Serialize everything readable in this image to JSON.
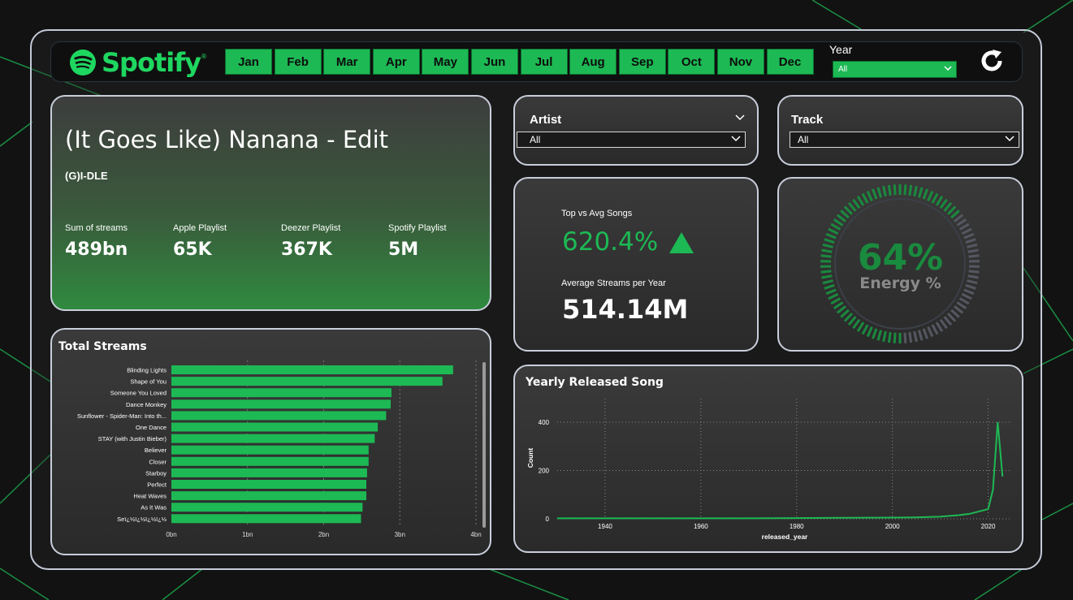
{
  "brand": {
    "name": "Spotify",
    "color": "#1db954"
  },
  "months": [
    "Jan",
    "Feb",
    "Mar",
    "Apr",
    "May",
    "Jun",
    "Jul",
    "Aug",
    "Sep",
    "Oct",
    "Nov",
    "Dec"
  ],
  "year_filter": {
    "label": "Year",
    "value": "All"
  },
  "refresh_icon": "refresh-icon",
  "top_song": {
    "title": "(It Goes Like) Nanana - Edit",
    "artist": "(G)I-DLE",
    "kpis": [
      {
        "label": "Sum of streams",
        "value": "489bn"
      },
      {
        "label": "Apple Playlist",
        "value": "65K"
      },
      {
        "label": "Deezer Playlist",
        "value": "367K"
      },
      {
        "label": "Spotify Playlist",
        "value": "5M"
      }
    ]
  },
  "artist_filter": {
    "label": "Artist",
    "value": "All"
  },
  "track_filter": {
    "label": "Track",
    "value": "All"
  },
  "top_vs_avg": {
    "label": "Top vs Avg Songs",
    "value": "620.4%",
    "trend_icon": "up-triangle-icon",
    "avg_label": "Average Streams per Year",
    "avg_value": "514.14M"
  },
  "energy": {
    "value": "64%",
    "label": "Energy %",
    "fraction": 0.64
  },
  "total_streams": {
    "title": "Total Streams",
    "chart_data": {
      "type": "bar",
      "orientation": "horizontal",
      "categories": [
        "Blinding Lights",
        "Shape of You",
        "Someone You Loved",
        "Dance Monkey",
        "Sunflower - Spider-Man: Into th...",
        "One Dance",
        "STAY (with Justin Bieber)",
        "Believer",
        "Closer",
        "Starboy",
        "Perfect",
        "Heat Waves",
        "As It Was",
        "Seï¿½ï¿½ï¿½ï¿½"
      ],
      "values": [
        3.7,
        3.56,
        2.89,
        2.88,
        2.82,
        2.71,
        2.67,
        2.59,
        2.59,
        2.57,
        2.56,
        2.56,
        2.51,
        2.49
      ],
      "xticks": [
        "0bn",
        "1bn",
        "2bn",
        "3bn",
        "4bn"
      ],
      "xlim": [
        0,
        4
      ],
      "color": "#1db954",
      "grid": true
    }
  },
  "yearly_released": {
    "title": "Yearly Released Song",
    "chart_data": {
      "type": "line",
      "xlabel": "released_year",
      "ylabel": "Count",
      "xticks": [
        1940,
        1960,
        1980,
        2000,
        2020
      ],
      "yticks": [
        0,
        200,
        400
      ],
      "xlim": [
        1930,
        2025
      ],
      "ylim": [
        0,
        420
      ],
      "color": "#1db954",
      "grid": true,
      "x": [
        1930,
        1940,
        1950,
        1960,
        1970,
        1980,
        1990,
        2000,
        2005,
        2010,
        2012,
        2014,
        2015,
        2016,
        2017,
        2018,
        2019,
        2020,
        2021,
        2022,
        2023
      ],
      "y": [
        2,
        2,
        2,
        2,
        2,
        3,
        4,
        5,
        6,
        9,
        12,
        15,
        18,
        20,
        25,
        30,
        35,
        40,
        120,
        400,
        175
      ]
    }
  }
}
